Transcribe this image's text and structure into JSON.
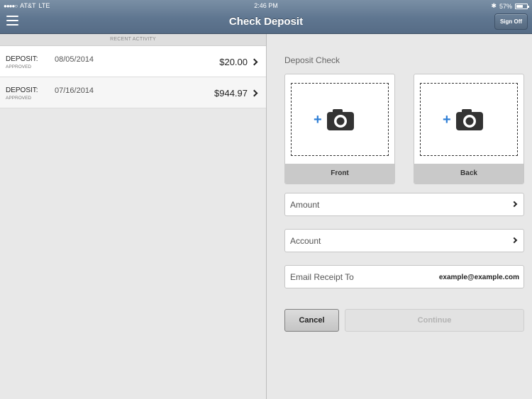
{
  "status_bar": {
    "signal": "●●●●○",
    "carrier": "AT&T",
    "network": "LTE",
    "time": "2:46 PM",
    "bluetooth": "✱",
    "battery_percent": "57%",
    "battery_level": 0.57
  },
  "header": {
    "title": "Check Deposit",
    "sign_off_label": "Sign Off"
  },
  "recent_activity": {
    "header": "RECENT ACTIVITY",
    "items": [
      {
        "type": "DEPOSIT:",
        "status": "APPROVED",
        "date": "08/05/2014",
        "amount": "$20.00"
      },
      {
        "type": "DEPOSIT:",
        "status": "APPROVED",
        "date": "07/16/2014",
        "amount": "$944.97"
      }
    ]
  },
  "deposit": {
    "section_title": "Deposit Check",
    "front_label": "Front",
    "back_label": "Back",
    "plus_glyph": "+",
    "amount_label": "Amount",
    "account_label": "Account",
    "email_label": "Email Receipt To",
    "email_value": "example@example.com",
    "cancel_label": "Cancel",
    "continue_label": "Continue"
  }
}
